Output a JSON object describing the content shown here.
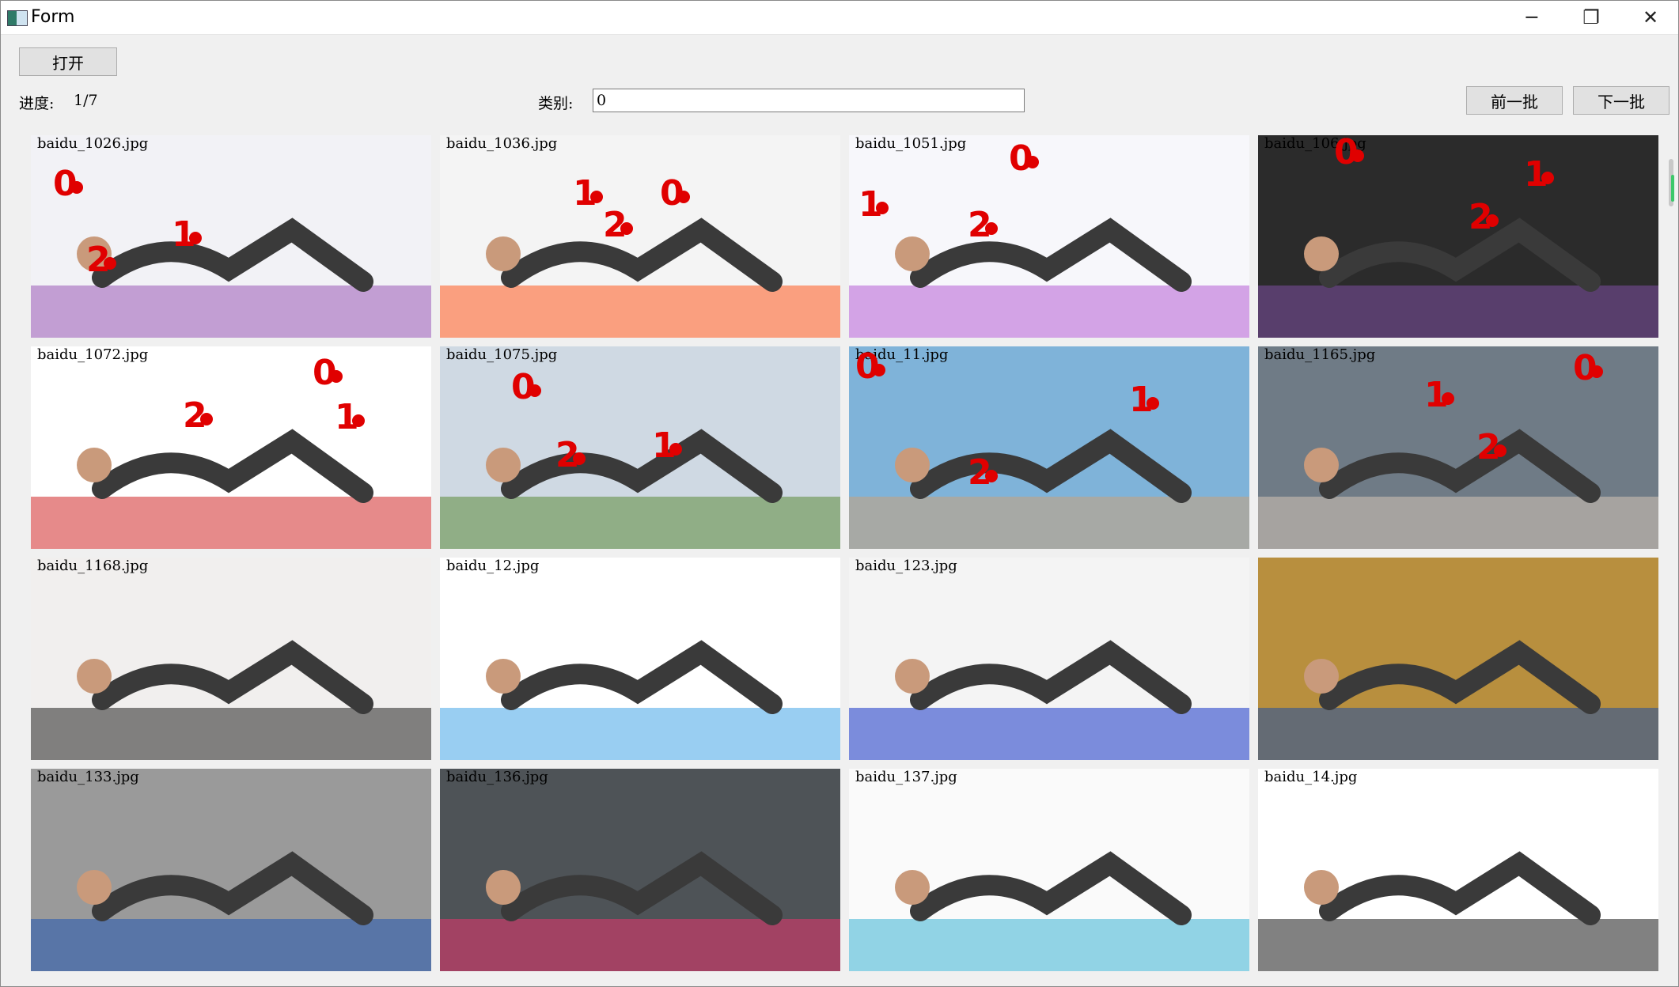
{
  "window": {
    "title": "Form",
    "minimize": "─",
    "maximize": "❐",
    "close": "✕"
  },
  "toolbar": {
    "open_label": "打开",
    "progress_label": "进度:",
    "progress_value": "1/7",
    "category_label": "类别:",
    "category_value": "0",
    "prev_label": "前一批",
    "next_label": "下一批"
  },
  "images": [
    {
      "name": "baidu_1026.jpg",
      "bg": "#f2f2f6",
      "accent": "#9b59b6"
    },
    {
      "name": "baidu_1036.jpg",
      "bg": "#f4f4f4",
      "accent": "#ff5a1f"
    },
    {
      "name": "baidu_1051.jpg",
      "bg": "#f7f7fb",
      "accent": "#b65fd6"
    },
    {
      "name": "baidu_106.jpg",
      "bg": "#2b2b2b",
      "accent": "#7d4ea3"
    },
    {
      "name": "baidu_1072.jpg",
      "bg": "#ffffff",
      "accent": "#d22a2a"
    },
    {
      "name": "baidu_1075.jpg",
      "bg": "#cfd9e3",
      "accent": "#5c8a3a"
    },
    {
      "name": "baidu_11.jpg",
      "bg": "#7fb3d9",
      "accent": "#c8a07a"
    },
    {
      "name": "baidu_1165.jpg",
      "bg": "#6f7b86",
      "accent": "#d3c5b6"
    },
    {
      "name": "baidu_1168.jpg",
      "bg": "#f1efee",
      "accent": "#222222"
    },
    {
      "name": "baidu_12.jpg",
      "bg": "#ffffff",
      "accent": "#45a6e8"
    },
    {
      "name": "baidu_123.jpg",
      "bg": "#f4f4f4",
      "accent": "#1836c8"
    },
    {
      "name": "",
      "bg": "#b88f3e",
      "accent": "#1f4fa0"
    },
    {
      "name": "baidu_133.jpg",
      "bg": "#9a9a9a",
      "accent": "#2257b3"
    },
    {
      "name": "baidu_136.jpg",
      "bg": "#4e5357",
      "accent": "#e8356e"
    },
    {
      "name": "baidu_137.jpg",
      "bg": "#fafafa",
      "accent": "#3ab3d3"
    },
    {
      "name": "baidu_14.jpg",
      "bg": "#ffffff",
      "accent": "#1a1a1a"
    }
  ],
  "keypoints": [
    {
      "tile": 0,
      "label": "0"
    },
    {
      "tile": 0,
      "label": "1"
    },
    {
      "tile": 0,
      "label": "2"
    },
    {
      "tile": 1,
      "label": "1"
    },
    {
      "tile": 1,
      "label": "2"
    },
    {
      "tile": 1,
      "label": "0"
    },
    {
      "tile": 2,
      "label": "0"
    },
    {
      "tile": 2,
      "label": "1"
    },
    {
      "tile": 2,
      "label": "2"
    },
    {
      "tile": 3,
      "label": "0"
    },
    {
      "tile": 3,
      "label": "1"
    },
    {
      "tile": 3,
      "label": "2"
    },
    {
      "tile": 4,
      "label": "0"
    },
    {
      "tile": 4,
      "label": "2"
    },
    {
      "tile": 4,
      "label": "1"
    },
    {
      "tile": 5,
      "label": "0"
    },
    {
      "tile": 5,
      "label": "2"
    },
    {
      "tile": 5,
      "label": "1"
    },
    {
      "tile": 6,
      "label": "0"
    },
    {
      "tile": 6,
      "label": "1"
    },
    {
      "tile": 6,
      "label": "2"
    },
    {
      "tile": 7,
      "label": "0"
    },
    {
      "tile": 7,
      "label": "1"
    },
    {
      "tile": 7,
      "label": "2"
    }
  ]
}
